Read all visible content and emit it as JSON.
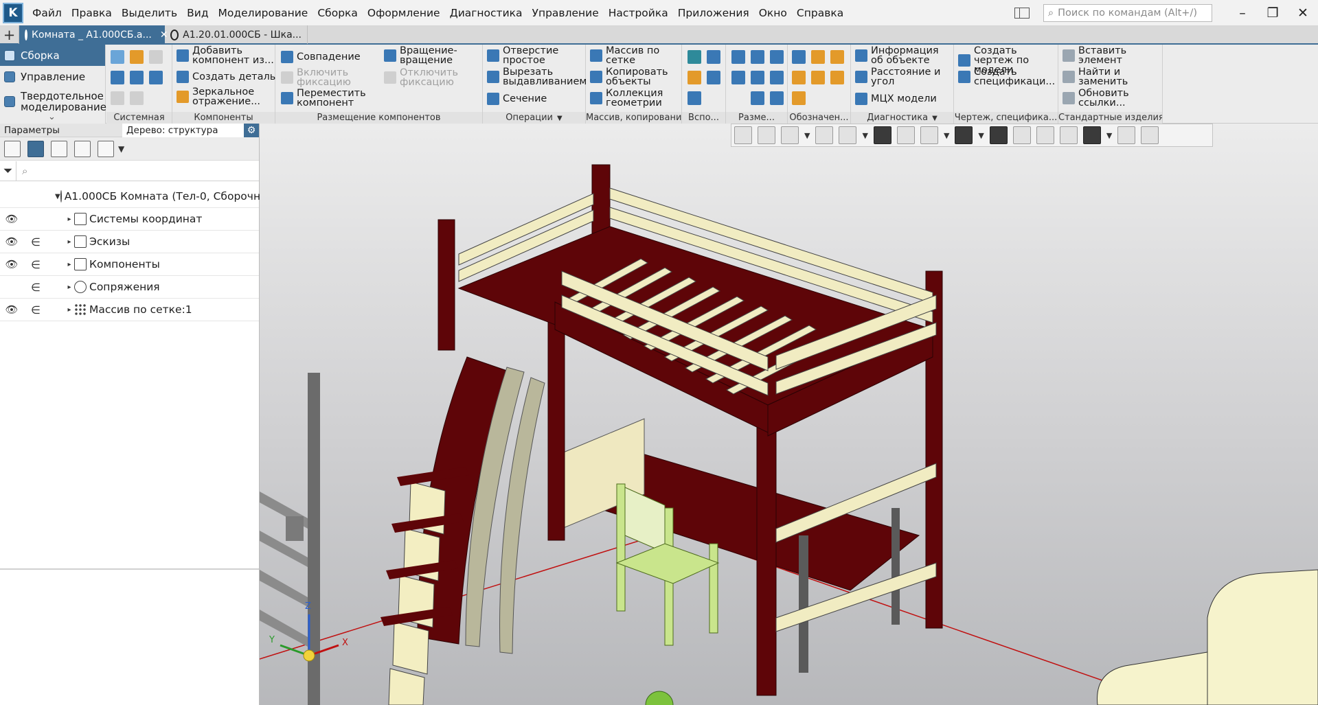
{
  "menu": {
    "items": [
      "Файл",
      "Правка",
      "Выделить",
      "Вид",
      "Моделирование",
      "Сборка",
      "Оформление",
      "Диагностика",
      "Управление",
      "Настройка",
      "Приложения",
      "Окно",
      "Справка"
    ],
    "search_placeholder": "Поиск по командам (Alt+/)"
  },
  "tabs": [
    {
      "label": "Комната _ А1.000СБ.а..."
    },
    {
      "label": "А1.20.01.000СБ - Шка..."
    }
  ],
  "ribbon": {
    "left_tabs": [
      "Сборка",
      "Управление",
      "Твердотельное моделирование"
    ],
    "groups": {
      "system": "Системная",
      "components": "Компоненты",
      "placement": "Размещение компонентов",
      "operations": "Операции",
      "array": "Массив, копирование",
      "aux": "Вспо...",
      "dims": "Разме...",
      "notation": "Обозначен...",
      "diag": "Диагностика",
      "drawing": "Чертеж, специфика...",
      "std": "Стандартные изделия"
    },
    "buttons": {
      "add_component": "Добавить компонент из...",
      "create_part": "Создать деталь",
      "mirror": "Зеркальное отражение...",
      "coincidence": "Совпадение",
      "fix_on": "Включить фиксацию",
      "move": "Переместить компонент",
      "rotation": "Вращение-вращение",
      "fix_off": "Отключить фиксацию",
      "hole": "Отверстие простое",
      "extrude_cut": "Вырезать выдавливанием",
      "section": "Сечение",
      "grid_array": "Массив по сетке",
      "copy_objects": "Копировать объекты",
      "geometry_collection": "Коллекция геометрии",
      "object_info": "Информация об объекте",
      "distance_angle": "Расстояние и угол",
      "mcx": "МЦХ модели",
      "create_drawing": "Создать чертеж по модели",
      "create_spec": "Создать спецификаци...",
      "insert_element": "Вставить элемент",
      "find_replace": "Найти и заменить",
      "update_links": "Обновить ссылки..."
    }
  },
  "panel": {
    "tab_params": "Параметры",
    "tab_tree": "Дерево: структура",
    "filter_placeholder": "",
    "tree": [
      {
        "label": "А1.000СБ Комната (Тел-0, Сборочн",
        "eye": "",
        "dep": ""
      },
      {
        "label": "Системы координат",
        "eye": "👁",
        "dep": ""
      },
      {
        "label": "Эскизы",
        "eye": "👁",
        "dep": "∈"
      },
      {
        "label": "Компоненты",
        "eye": "👁",
        "dep": "∈"
      },
      {
        "label": "Сопряжения",
        "eye": "",
        "dep": "∈"
      },
      {
        "label": "Массив по сетке:1",
        "eye": "👁",
        "dep": "∈"
      }
    ]
  },
  "viewport": {
    "axis_labels": {
      "x": "X",
      "y": "Y",
      "z": "Z"
    }
  },
  "colors": {
    "accent": "#3f6e96",
    "bed_frame": "#5e0508",
    "slats": "#f1ecc2",
    "chair": "#c9e58c"
  }
}
